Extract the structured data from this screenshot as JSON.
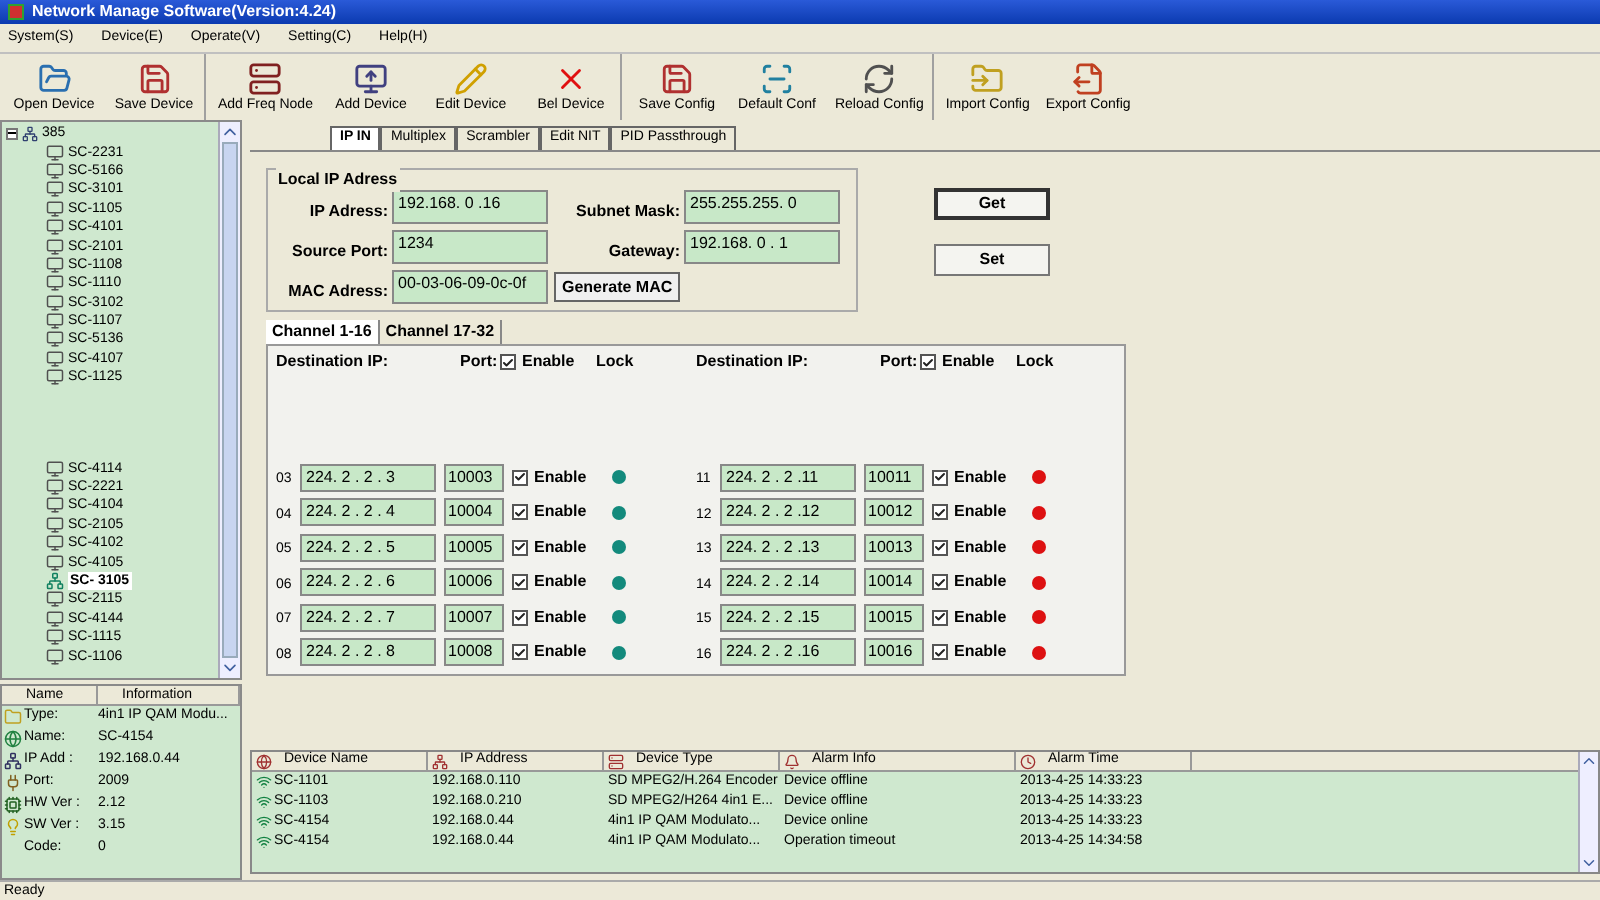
{
  "window": {
    "title": "Network Manage Software(Version:4.24)"
  },
  "menu": [
    "System(S)",
    "Device(E)",
    "Operate(V)",
    "Setting(C)",
    "Help(H)"
  ],
  "toolbar_groups": [
    [
      {
        "label": "Open Device",
        "kind": "open"
      },
      {
        "label": "Save Device",
        "kind": "save"
      }
    ],
    [
      {
        "label": "Add Freq Node",
        "kind": "node"
      },
      {
        "label": "Add Device",
        "kind": "add"
      },
      {
        "label": "Edit Device",
        "kind": "edit"
      },
      {
        "label": "Bel Device",
        "kind": "delete"
      }
    ],
    [
      {
        "label": "Save Config",
        "kind": "save"
      },
      {
        "label": "Default Conf",
        "kind": "scanner"
      },
      {
        "label": "Reload Config",
        "kind": "reload"
      }
    ],
    [
      {
        "label": "Import Config",
        "kind": "folder"
      },
      {
        "label": "Export Config",
        "kind": "export"
      }
    ]
  ],
  "device_tree": {
    "label": "385",
    "expanded": true,
    "children_top": [
      {
        "label": "SC-2231",
        "selected": false
      },
      {
        "label": "SC-5166",
        "selected": false
      },
      {
        "label": "SC-3101",
        "selected": false
      },
      {
        "label": "SC-1105",
        "selected": false
      },
      {
        "label": "SC-4101",
        "selected": false
      },
      {
        "label": "SC-2101",
        "selected": false
      },
      {
        "label": "SC-1108",
        "selected": false
      },
      {
        "label": "SC-1110",
        "selected": false
      },
      {
        "label": "SC-3102",
        "selected": false
      },
      {
        "label": "SC-1107",
        "selected": false
      },
      {
        "label": "SC-5136",
        "selected": false
      },
      {
        "label": "SC-4107",
        "selected": false
      },
      {
        "label": "SC-1125",
        "selected": false
      }
    ],
    "children_bottom": [
      {
        "label": "SC-4114",
        "selected": false
      },
      {
        "label": "SC-2221",
        "selected": false
      },
      {
        "label": "SC-4104",
        "selected": false
      },
      {
        "label": "SC-2105",
        "selected": false
      },
      {
        "label": "SC-4102",
        "selected": false
      },
      {
        "label": "SC-4105",
        "selected": false
      },
      {
        "label": "SC- 3105",
        "selected": true
      },
      {
        "label": "SC-2115",
        "selected": false
      },
      {
        "label": "SC-4144",
        "selected": false
      },
      {
        "label": "SC-1115",
        "selected": false
      },
      {
        "label": "SC-1106",
        "selected": false
      }
    ]
  },
  "info_panel": {
    "columns": [
      "Name",
      "Information"
    ],
    "rows": [
      {
        "kind": "type",
        "label": "Type:",
        "value": "4in1 IP QAM Modu..."
      },
      {
        "kind": "name",
        "label": "Name:",
        "value": "SC-4154"
      },
      {
        "kind": "ip",
        "label": "IP Add :",
        "value": "192.168.0.44"
      },
      {
        "kind": "port",
        "label": "Port:",
        "value": "2009"
      },
      {
        "kind": "hw",
        "label": "HW Ver :",
        "value": "2.12"
      },
      {
        "kind": "sw",
        "label": "SW Ver :",
        "value": "3.15"
      },
      {
        "kind": "none",
        "label": "Code:",
        "value": "0"
      }
    ]
  },
  "tabs": [
    {
      "label": "IP IN",
      "selected": true
    },
    {
      "label": "Multiplex",
      "selected": false
    },
    {
      "label": "Scrambler",
      "selected": false
    },
    {
      "label": "Edit NIT",
      "selected": false
    },
    {
      "label": "PID Passthrough",
      "selected": false
    }
  ],
  "local_ip": {
    "title": "Local IP Adress",
    "fields": [
      {
        "label": "IP Adress:",
        "value": "192.168. 0 .16"
      },
      {
        "label": "Subnet Mask:",
        "value": "255.255.255. 0"
      },
      {
        "label": "Source Port:",
        "value": "1234"
      },
      {
        "label": "Gateway:",
        "value": "192.168. 0 . 1"
      },
      {
        "label": "MAC Adress:",
        "value": "00-03-06-09-0c-0f"
      }
    ],
    "generate_button": "Generate MAC"
  },
  "actions": [
    "Get",
    "Set"
  ],
  "channel_tabs": [
    {
      "label": "Channel 1-16",
      "selected": true
    },
    {
      "label": "Channel 17-32",
      "selected": false
    }
  ],
  "channel_columns": [
    {
      "destination": "Destination IP:",
      "port": "Port:",
      "enable": "Enable",
      "enable_checked": true,
      "lock": "Lock",
      "rows": [
        {
          "number": "03",
          "ip": "224. 2 . 2 . 3",
          "port": "10003",
          "enabled": true,
          "enable_label": "Enable",
          "color": "#138a7c"
        },
        {
          "number": "04",
          "ip": "224. 2 . 2 . 4",
          "port": "10004",
          "enabled": true,
          "enable_label": "Enable",
          "color": "#138a7c"
        },
        {
          "number": "05",
          "ip": "224. 2 . 2 . 5",
          "port": "10005",
          "enabled": true,
          "enable_label": "Enable",
          "color": "#138a7c"
        },
        {
          "number": "06",
          "ip": "224. 2 . 2 . 6",
          "port": "10006",
          "enabled": true,
          "enable_label": "Enable",
          "color": "#138a7c"
        },
        {
          "number": "07",
          "ip": "224. 2 . 2 . 7",
          "port": "10007",
          "enabled": true,
          "enable_label": "Enable",
          "color": "#138a7c"
        },
        {
          "number": "08",
          "ip": "224. 2 . 2 . 8",
          "port": "10008",
          "enabled": true,
          "enable_label": "Enable",
          "color": "#138a7c"
        }
      ]
    },
    {
      "destination": "Destination IP:",
      "port": "Port:",
      "enable": "Enable",
      "enable_checked": true,
      "lock": "Lock",
      "rows": [
        {
          "number": "11",
          "ip": "224. 2 . 2 .11",
          "port": "10011",
          "enabled": true,
          "enable_label": "Enable",
          "color": "#dd1111"
        },
        {
          "number": "12",
          "ip": "224. 2 . 2 .12",
          "port": "10012",
          "enabled": true,
          "enable_label": "Enable",
          "color": "#dd1111"
        },
        {
          "number": "13",
          "ip": "224. 2 . 2 .13",
          "port": "10013",
          "enabled": true,
          "enable_label": "Enable",
          "color": "#dd1111"
        },
        {
          "number": "14",
          "ip": "224. 2 . 2 .14",
          "port": "10014",
          "enabled": true,
          "enable_label": "Enable",
          "color": "#dd1111"
        },
        {
          "number": "15",
          "ip": "224. 2 . 2 .15",
          "port": "10015",
          "enabled": true,
          "enable_label": "Enable",
          "color": "#dd1111"
        },
        {
          "number": "16",
          "ip": "224. 2 . 2 .16",
          "port": "10016",
          "enabled": true,
          "enable_label": "Enable",
          "color": "#dd1111"
        }
      ]
    }
  ],
  "alarm_table": {
    "columns": [
      "Device Name",
      "IP Address",
      "Device Type",
      "Alarm Info",
      "Alarm Time"
    ],
    "rows": [
      [
        "SC-1101",
        "192.168.0.110",
        "SD MPEG2/H.264 Encoder",
        "Device offline",
        "2013-4-25 14:33:23"
      ],
      [
        "SC-1103",
        "192.168.0.210",
        "SD MPEG2/H264 4in1 E...",
        "Device offline",
        "2013-4-25 14:33:23"
      ],
      [
        "SC-4154",
        "192.168.0.44",
        "4in1 IP QAM Modulato...",
        "Device online",
        "2013-4-25 14:33:23"
      ],
      [
        "SC-4154",
        "192.168.0.44",
        "4in1 IP QAM Modulato...",
        "Operation timeout",
        "2013-4-25 14:34:58"
      ]
    ]
  },
  "status_bar": "Ready"
}
